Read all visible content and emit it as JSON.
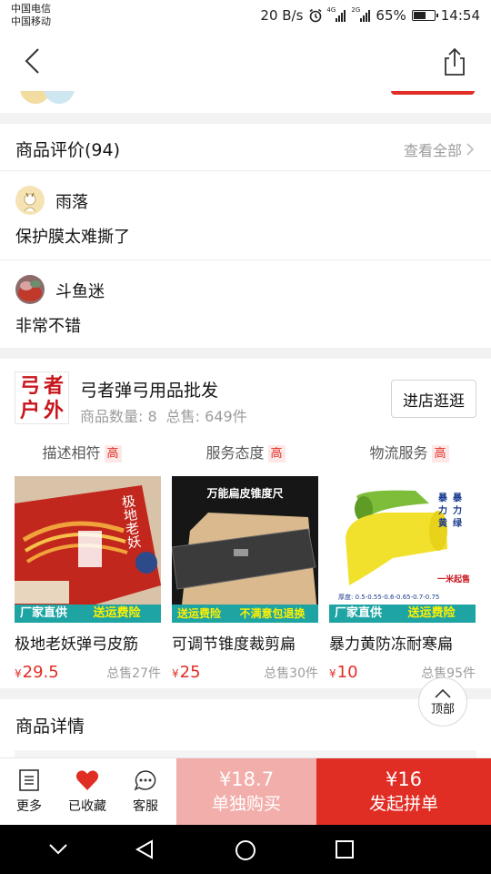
{
  "status_bar": {
    "carrier_1": "中国电信",
    "carrier_2": "中国移动",
    "net_speed": "20 B/s",
    "sig1_tag": "4G",
    "sig2_tag": "2G",
    "battery": "65%",
    "battery_level": 0.65,
    "time": "14:54"
  },
  "reviews": {
    "title": "商品评价(94)",
    "view_all": "查看全部",
    "items": [
      {
        "name": "雨落",
        "text": "保护膜太难撕了"
      },
      {
        "name": "斗鱼迷",
        "text": "非常不错"
      }
    ]
  },
  "store": {
    "logo_chars": [
      "弓",
      "者",
      "户",
      "外"
    ],
    "name": "弓者弹弓用品批发",
    "goods_count": "商品数量: 8",
    "total_sold": "总售: 649件",
    "enter_button": "进店逛逛",
    "ratings": [
      {
        "label": "描述相符",
        "badge": "高"
      },
      {
        "label": "服务态度",
        "badge": "高"
      },
      {
        "label": "物流服务",
        "badge": "高"
      }
    ],
    "products": [
      {
        "title": "极地老妖弹弓皮筋",
        "currency": "¥",
        "price": "29.5",
        "sold": "总售27件",
        "banner_left": "厂家直供",
        "banner_right": "送运费险",
        "img_text": "极地老妖"
      },
      {
        "title": "可调节锥度裁剪扁",
        "currency": "¥",
        "price": "25",
        "sold": "总售30件",
        "banner_left": "送运费险",
        "banner_right": "不满意包退换",
        "img_text": "万能扁皮锥度尺"
      },
      {
        "title": "暴力黄防冻耐寒扁",
        "currency": "¥",
        "price": "10",
        "sold": "总售95件",
        "banner_left": "厂家直供",
        "banner_right": "送运费险",
        "img_text_1": "暴",
        "img_text_2": "力",
        "img_text_3": "黄",
        "img_text_4": "暴",
        "img_text_5": "力",
        "img_text_6": "绿",
        "img_tag": "一米起售",
        "img_spec": "厚度: 0.5-0.55-0.6-0.65-0.7-0.75"
      }
    ]
  },
  "details": {
    "title": "商品详情"
  },
  "top_button": {
    "label": "顶部"
  },
  "bottom_bar": {
    "more": "更多",
    "favorited": "已收藏",
    "service": "客服",
    "single_price": "¥18.7",
    "single_label": "单独购买",
    "group_price": "¥16",
    "group_label": "发起拼单"
  },
  "colors": {
    "accent": "#e02e24",
    "accent_light": "#f2aeab",
    "muted": "#9c9c9c",
    "banner": "#1fa4a4"
  }
}
